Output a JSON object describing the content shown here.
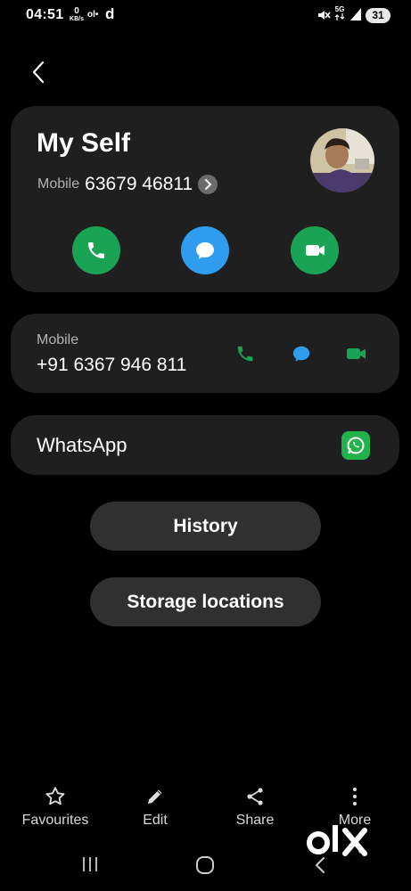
{
  "status_bar": {
    "time": "04:51",
    "net_speed_value": "0",
    "net_speed_unit": "KB/s",
    "ole_label": "ol•",
    "d_icon_label": "d",
    "network_label": "5G",
    "battery": "31"
  },
  "contact": {
    "name": "My Self",
    "mobile_label": "Mobile",
    "mobile_number": "63679 46811"
  },
  "number_card": {
    "label": "Mobile",
    "number": "+91 6367 946 811"
  },
  "whatsapp": {
    "label": "WhatsApp"
  },
  "buttons": {
    "history": "History",
    "storage": "Storage locations"
  },
  "bottom_nav": [
    {
      "label": "Favourites",
      "icon": "star-icon"
    },
    {
      "label": "Edit",
      "icon": "pencil-icon"
    },
    {
      "label": "Share",
      "icon": "share-icon"
    },
    {
      "label": "More",
      "icon": "more-vertical-icon"
    }
  ],
  "watermark": "OLX",
  "colors": {
    "card_bg": "#1f1f1f",
    "call_green": "#1aa255",
    "message_blue": "#2f9cf0",
    "whatsapp_green": "#22b24c",
    "pill_bg": "#303030"
  }
}
